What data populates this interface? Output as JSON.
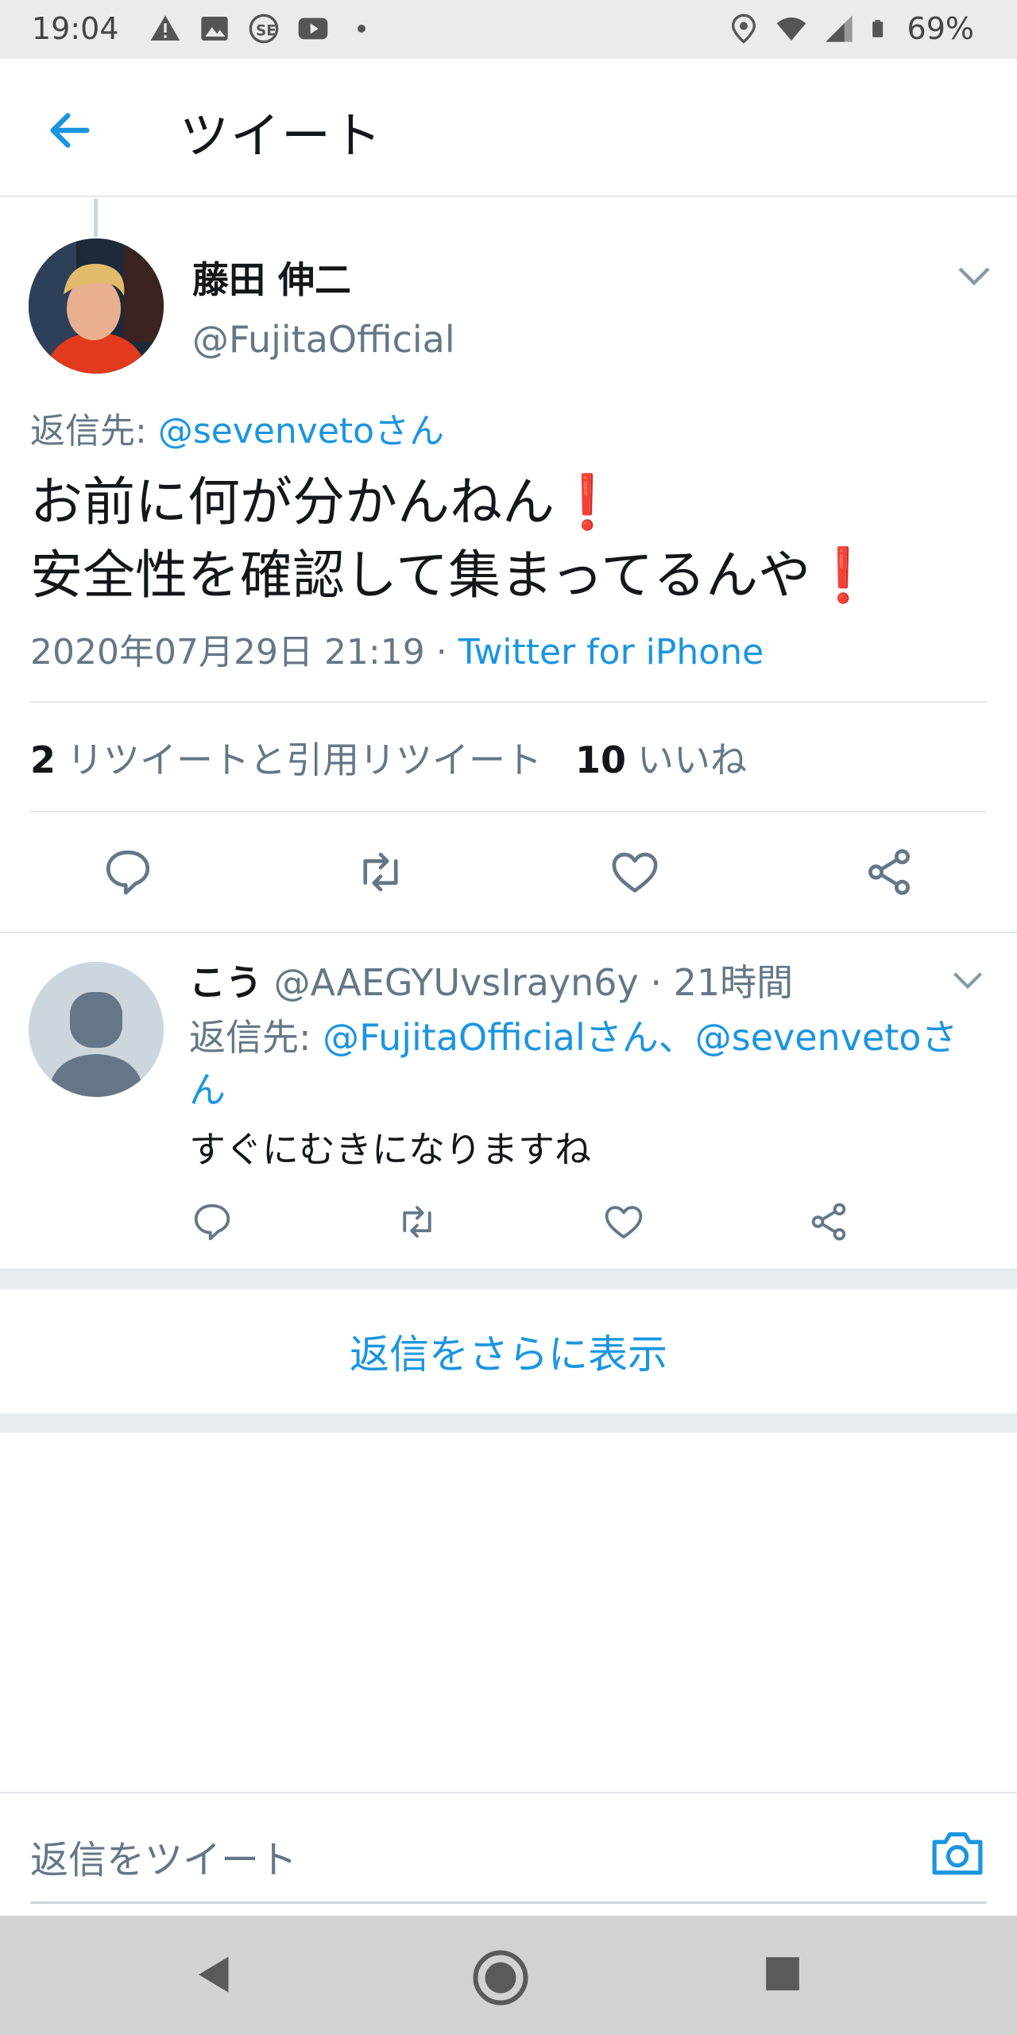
{
  "status_bar": {
    "time": "19:04",
    "battery": "69%",
    "left_icons": [
      "warning-icon",
      "image-icon",
      "app-icon",
      "youtube-icon",
      "dot"
    ],
    "right_icons": [
      "location-icon",
      "wifi-icon",
      "signal-icon",
      "battery-icon"
    ]
  },
  "header": {
    "title": "ツイート"
  },
  "tweet": {
    "author_name": "藤田 伸二",
    "author_handle": "@FujitaOfficial",
    "reply_to_label": "返信先: ",
    "reply_to_mention": "@sevenvetoさん",
    "line1": "お前に何が分かんねん",
    "line2": "安全性を確認して集まってるんや",
    "timestamp": "2020年07月29日 21:19",
    "meta_separator": " · ",
    "source": "Twitter for iPhone",
    "retweet_count": "2",
    "retweet_label": "リツイートと引用リツイート",
    "like_count": "10",
    "like_label": "いいね"
  },
  "reply": {
    "name": "こう",
    "handle_time": " @AAEGYUvsIrayn6y · 21時間",
    "reply_to_label": "返信先: ",
    "reply_to_mentions": "@FujitaOfficialさん、@sevenvetoさん",
    "text": "すぐにむきになりますね"
  },
  "show_more": "返信をさらに表示",
  "compose": {
    "placeholder": "返信をツイート"
  },
  "colors": {
    "accent": "#1b95e0",
    "secondary_text": "#657786",
    "divider": "#e1e8ed",
    "exclamation": "#d01b2c"
  }
}
